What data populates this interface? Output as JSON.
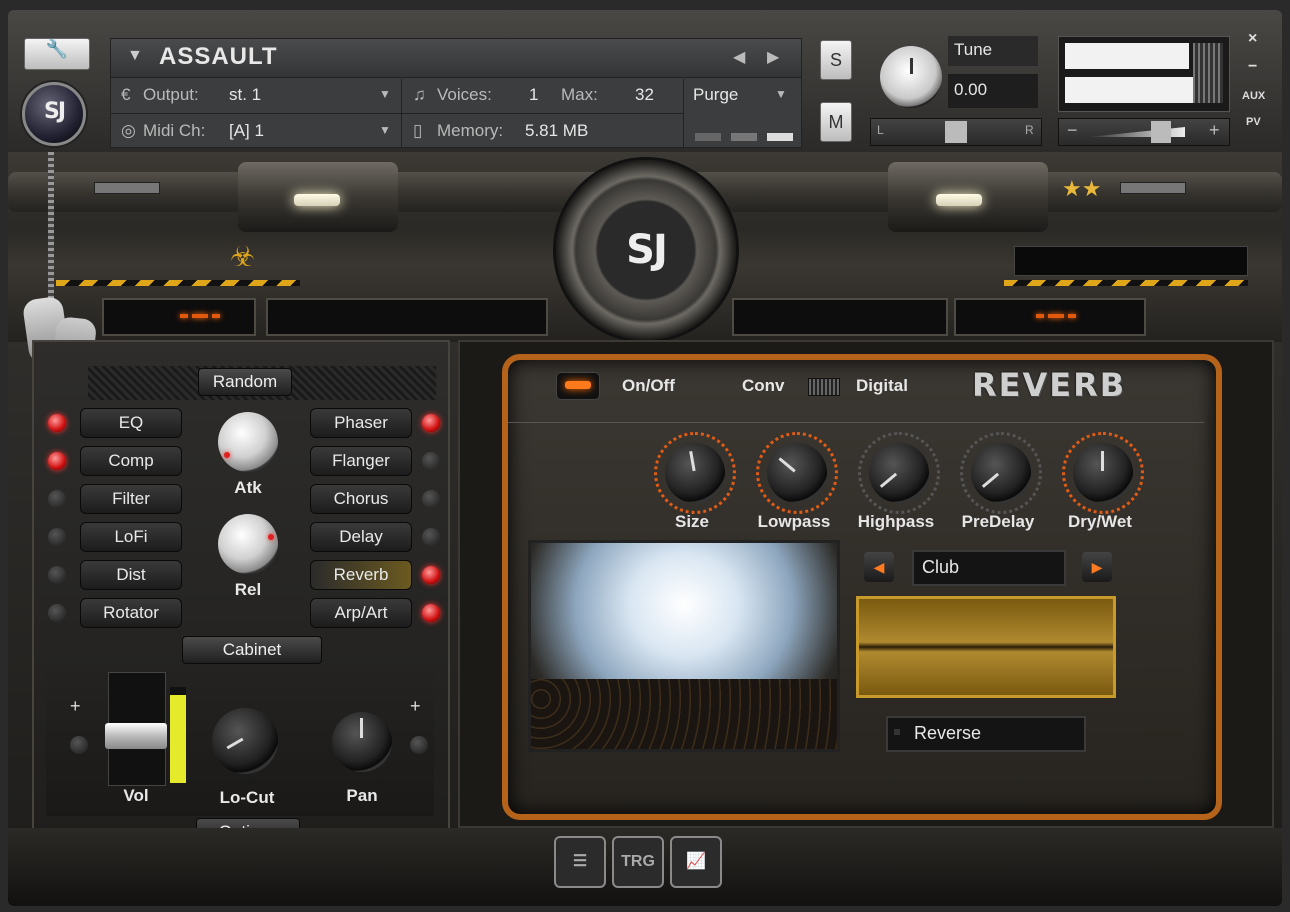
{
  "header": {
    "instrument_name": "ASSAULT",
    "output_label": "Output:",
    "output_value": "st. 1",
    "midi_label": "Midi Ch:",
    "midi_value": "[A] 1",
    "voices_label": "Voices:",
    "voices_value": "1",
    "max_label": "Max:",
    "max_value": "32",
    "memory_label": "Memory:",
    "memory_value": "5.81 MB",
    "purge_label": "Purge",
    "solo_label": "S",
    "mute_label": "M",
    "tune_label": "Tune",
    "tune_value": "0.00",
    "pan_left": "L",
    "pan_right": "R",
    "vol_minus": "−",
    "vol_plus": "+",
    "side_close": "×",
    "side_min": "−",
    "side_aux": "AUX",
    "side_pv": "PV"
  },
  "left_panel": {
    "random_label": "Random",
    "effects_left": [
      {
        "label": "EQ",
        "led": "on"
      },
      {
        "label": "Comp",
        "led": "on"
      },
      {
        "label": "Filter",
        "led": "off"
      },
      {
        "label": "LoFi",
        "led": "off"
      },
      {
        "label": "Dist",
        "led": "off"
      },
      {
        "label": "Rotator",
        "led": "off"
      }
    ],
    "effects_right": [
      {
        "label": "Phaser",
        "led": "on"
      },
      {
        "label": "Flanger",
        "led": "off"
      },
      {
        "label": "Chorus",
        "led": "off"
      },
      {
        "label": "Delay",
        "led": "off"
      },
      {
        "label": "Reverb",
        "led": "on"
      },
      {
        "label": "Arp/Art",
        "led": "on"
      }
    ],
    "atk_label": "Atk",
    "rel_label": "Rel",
    "cabinet_label": "Cabinet",
    "vol_label": "Vol",
    "locut_label": "Lo-Cut",
    "pan_label": "Pan",
    "options_label": "Options",
    "plus": "+"
  },
  "reverb": {
    "onoff_label": "On/Off",
    "conv_label": "Conv",
    "digital_label": "Digital",
    "title": "REVERB",
    "knobs": [
      "Size",
      "Lowpass",
      "Highpass",
      "PreDelay",
      "Dry/Wet"
    ],
    "preset": "Club",
    "reverse_label": "Reverse"
  },
  "bottom": {
    "trg_label": "TRG"
  },
  "colors": {
    "accent_orange": "#e0590c",
    "led_red": "#d01010",
    "meter_yellow": "#e5ea2a",
    "reverb_border": "#b5631a"
  }
}
